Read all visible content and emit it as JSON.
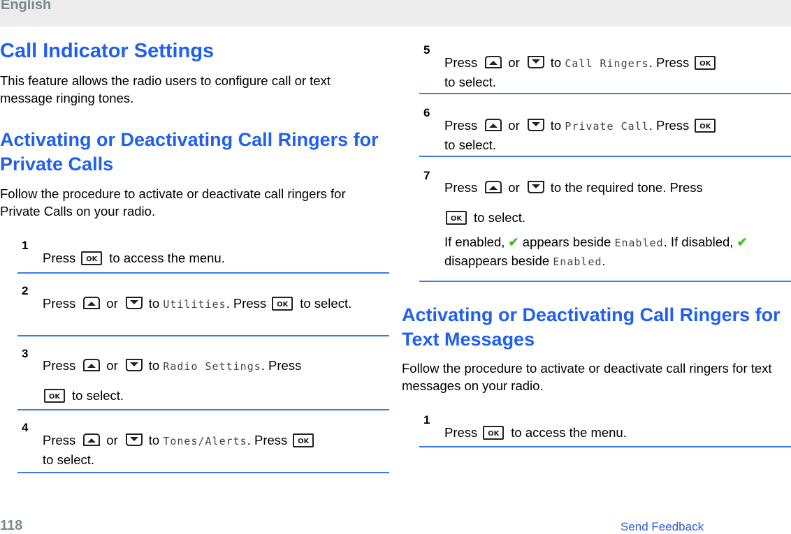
{
  "header": {
    "language": "English"
  },
  "left": {
    "title": "Call Indicator Settings",
    "intro": "This feature allows the radio users to configure call or text message ringing tones.",
    "section1": {
      "heading": "Activating or Deactivating Call Ringers for Private Calls",
      "description": "Follow the procedure to activate or deactivate call ringers for Private Calls on your radio.",
      "steps": [
        {
          "num": "1",
          "press": "Press",
          "after": "to access the menu."
        },
        {
          "num": "2",
          "press": "Press",
          "or": "or",
          "to": "to",
          "menu": "Utilities",
          "press2": ". Press",
          "after": "to select."
        },
        {
          "num": "3",
          "press": "Press",
          "or": "or",
          "to": "to",
          "menu": "Radio Settings",
          "press2": ". Press",
          "after": "to select."
        },
        {
          "num": "4",
          "press": "Press",
          "or": "or",
          "to": "to",
          "menu": "Tones/Alerts",
          "press2": ". Press",
          "after": "to select."
        }
      ]
    }
  },
  "right": {
    "steps": [
      {
        "num": "5",
        "press": "Press",
        "or": "or",
        "to": "to",
        "menu": "Call Ringers",
        "press2": ". Press",
        "after": "to select."
      },
      {
        "num": "6",
        "press": "Press",
        "or": "or",
        "to": "to",
        "menu": "Private Call",
        "press2": ". Press",
        "after": "to select."
      },
      {
        "num": "7",
        "press": "Press",
        "or": "or",
        "to": "to the required tone. Press",
        "after": "to select.",
        "note": {
          "p1": "If enabled,",
          "p2": "appears beside",
          "m1": "Enabled",
          "p3": ". If disabled,",
          "p4": "disappears beside",
          "m2": "Enabled",
          "p5": "."
        }
      }
    ],
    "section2": {
      "heading": "Activating or Deactivating Call Ringers for Text Messages",
      "description": "Follow the procedure to activate or deactivate call ringers for text messages on your radio.",
      "steps": [
        {
          "num": "1",
          "press": "Press",
          "after": "to access the menu."
        }
      ]
    }
  },
  "icons": {
    "ok_key": "OK",
    "checkmark": "✔"
  },
  "footer": {
    "page_number": "118",
    "feedback_link": "Send Feedback"
  },
  "colors": {
    "heading": "#2060f0",
    "divider": "#3a78f0",
    "check": "#3fbf1f",
    "gray": "#7a8a8a"
  }
}
